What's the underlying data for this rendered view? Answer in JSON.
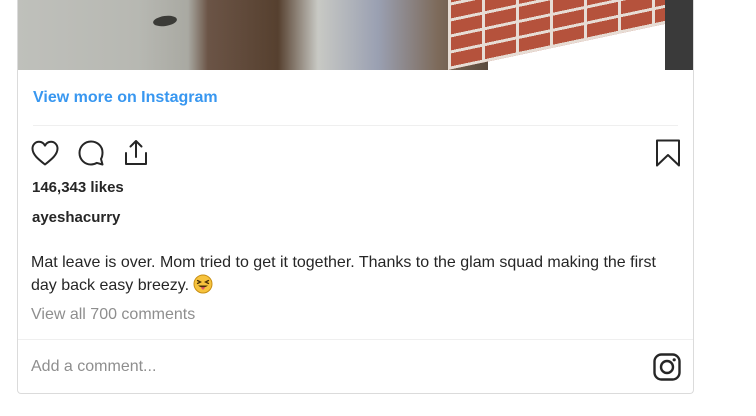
{
  "post": {
    "view_more_label": "View more on Instagram",
    "likes_text": "146,343 likes",
    "username": "ayeshacurry",
    "caption": "Mat leave is over. Mom tried to get it together. Thanks to the glam squad making the first day back easy breezy.",
    "caption_emoji": "squinting-face-with-tongue",
    "view_comments_label": "View all 700 comments",
    "comment_placeholder": "Add a comment..."
  },
  "icons": {
    "like": "heart-icon",
    "comment": "speech-bubble-icon",
    "share": "share-icon",
    "save": "bookmark-icon",
    "brand": "instagram-logo-icon"
  },
  "colors": {
    "link": "#3897f0",
    "text": "#262626",
    "muted": "#8e8e8e",
    "border": "#dbdbdb"
  }
}
